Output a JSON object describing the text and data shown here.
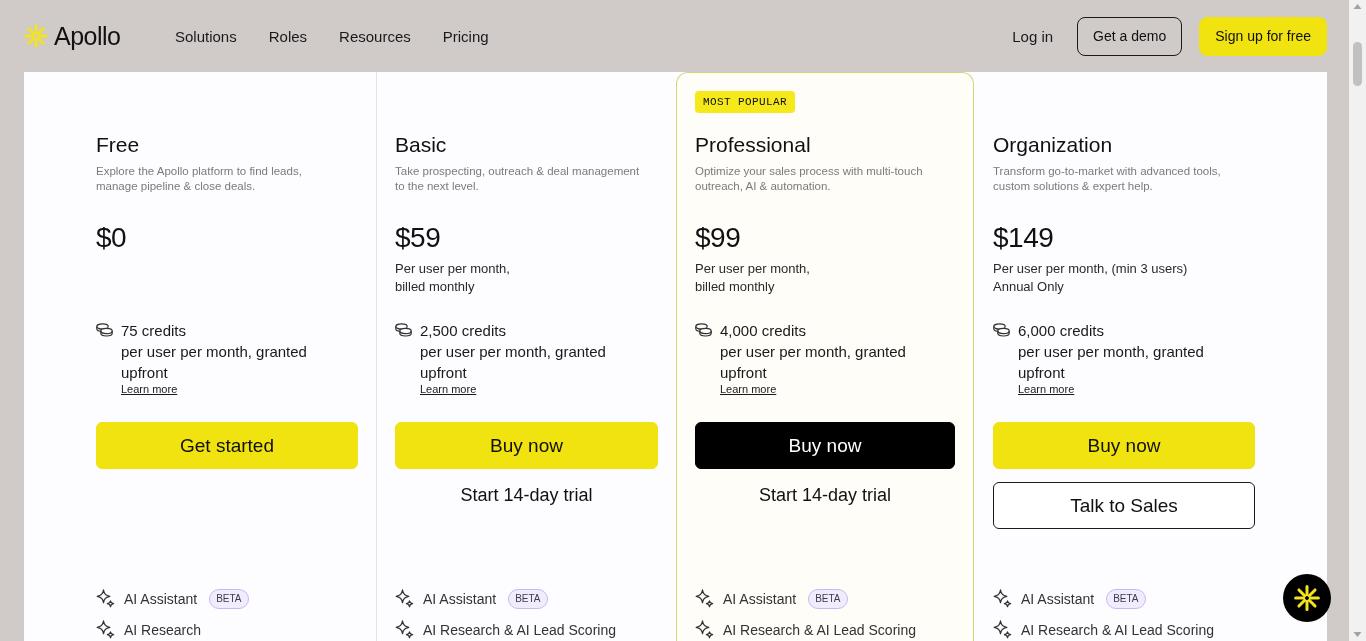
{
  "header": {
    "logo": "Apollo",
    "nav": [
      "Solutions",
      "Roles",
      "Resources",
      "Pricing"
    ],
    "login": "Log in",
    "buttons": [
      {
        "label": "Get a demo",
        "kind": "outline"
      },
      {
        "label": "Sign up for free",
        "kind": "primary"
      }
    ]
  },
  "plans": [
    {
      "name": "Free",
      "highlighted": false,
      "description": "Explore the Apollo platform to find leads,\nmanage pipeline & close deals.",
      "price": "$0",
      "credits": "75 credits\nper user per month, granted\nupfront",
      "learn_more": "Learn more",
      "actions": [
        {
          "label": "Get started",
          "kind": "primary"
        }
      ],
      "features": [
        {
          "label": "AI Assistant",
          "badge": "BETA"
        },
        {
          "label": "AI Research"
        }
      ]
    },
    {
      "name": "Basic",
      "highlighted": false,
      "description": "Take prospecting, outreach & deal management\nto the next level.",
      "price": "$59",
      "price_note": "Per user per month,\nbilled monthly",
      "credits": "2,500 credits\nper user per month, granted\nupfront",
      "learn_more": "Learn more",
      "actions": [
        {
          "label": "Buy now",
          "kind": "primary"
        },
        {
          "label": "Start 14-day trial",
          "kind": "text"
        }
      ],
      "features": [
        {
          "label": "AI Assistant",
          "badge": "BETA"
        },
        {
          "label": "AI Research & AI Lead Scoring"
        }
      ]
    },
    {
      "name": "Professional",
      "badge": "MOST POPULAR",
      "highlighted": true,
      "description": "Optimize your sales process with multi-touch\noutreach, AI & automation.",
      "price": "$99",
      "price_note": "Per user per month,\nbilled monthly",
      "credits": "4,000 credits\nper user per month, granted\nupfront",
      "learn_more": "Learn more",
      "actions": [
        {
          "label": "Buy now",
          "kind": "dark"
        },
        {
          "label": "Start 14-day trial",
          "kind": "text"
        }
      ],
      "features": [
        {
          "label": "AI Assistant",
          "badge": "BETA"
        },
        {
          "label": "AI Research & AI Lead Scoring"
        }
      ]
    },
    {
      "name": "Organization",
      "highlighted": false,
      "description": "Transform go-to-market with advanced tools,\ncustom solutions & expert help.",
      "price": "$149",
      "price_note": "Per user per month, (min 3 users)\nAnnual Only",
      "credits": "6,000 credits\nper user per month, granted\nupfront",
      "learn_more": "Learn more",
      "actions": [
        {
          "label": "Buy now",
          "kind": "primary"
        },
        {
          "label": "Talk to Sales",
          "kind": "outline"
        }
      ],
      "features": [
        {
          "label": "AI Assistant",
          "badge": "BETA"
        },
        {
          "label": "AI Research & AI Lead Scoring"
        }
      ]
    }
  ]
}
